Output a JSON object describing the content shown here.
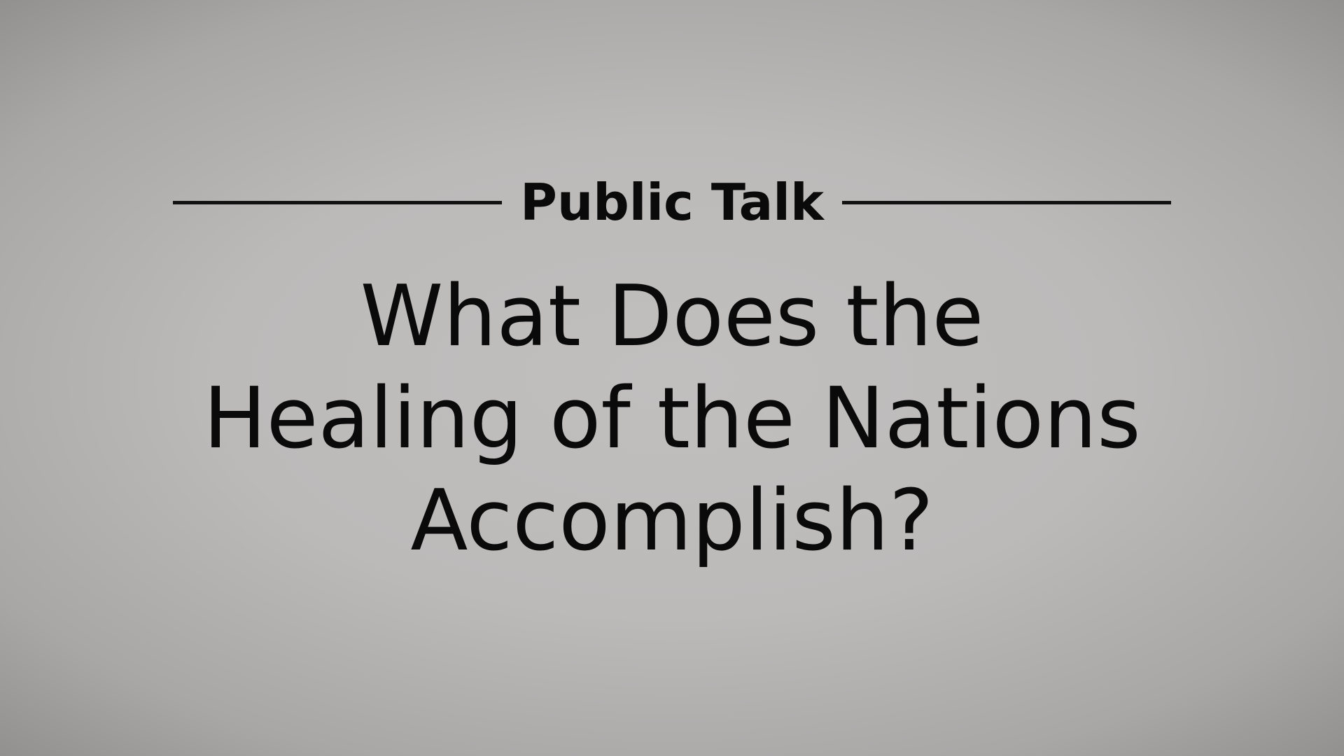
{
  "slide": {
    "eyebrow": "Public Talk",
    "title_lines": [
      "What Does the",
      "Healing of the Nations",
      "Accomplish?"
    ]
  }
}
